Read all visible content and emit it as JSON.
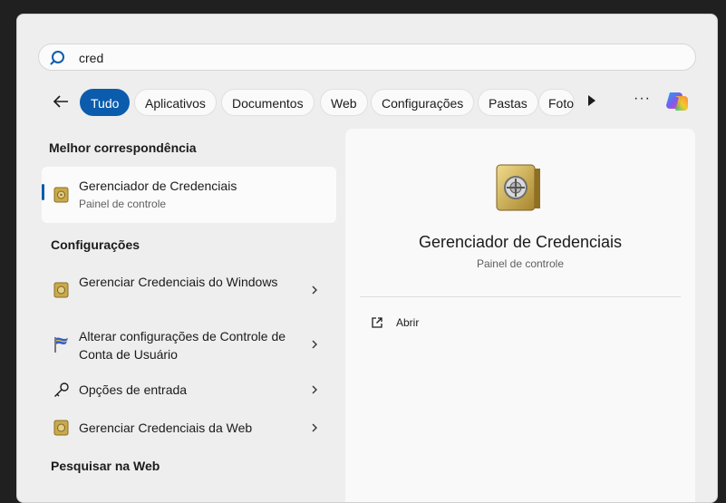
{
  "search": {
    "value": "cred",
    "icon": "search-icon"
  },
  "filters": {
    "items": [
      "Tudo",
      "Aplicativos",
      "Documentos",
      "Web",
      "Configurações",
      "Pastas",
      "Fotos"
    ],
    "more_label": "···"
  },
  "best_match": {
    "heading": "Melhor correspondência",
    "title": "Gerenciador de Credenciais",
    "subtitle": "Painel de controle"
  },
  "settings": {
    "heading": "Configurações",
    "items": [
      {
        "label": "Gerenciar Credenciais do Windows"
      },
      {
        "label": "Alterar configurações de Controle de Conta de Usuário"
      },
      {
        "label": "Opções de entrada"
      },
      {
        "label": "Gerenciar Credenciais da Web"
      }
    ]
  },
  "web": {
    "heading": "Pesquisar na Web"
  },
  "detail": {
    "title": "Gerenciador de Credenciais",
    "subtitle": "Painel de controle",
    "actions": [
      {
        "label": "Abrir"
      }
    ]
  },
  "colors": {
    "accent": "#0b5cad",
    "panel": "#eeeeee",
    "card": "#f9f9f9"
  }
}
